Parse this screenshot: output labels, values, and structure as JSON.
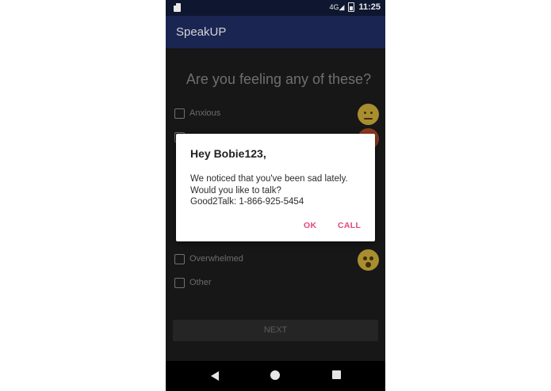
{
  "status_bar": {
    "network": "4G",
    "time": "11:25"
  },
  "app_bar": {
    "title": "SpeakUP"
  },
  "main": {
    "question": "Are you feeling any of these?",
    "options": [
      {
        "label": "Anxious"
      },
      {
        "label": ""
      },
      {
        "label": ""
      },
      {
        "label": ""
      },
      {
        "label": ""
      },
      {
        "label": ""
      },
      {
        "label": "Overwhelmed"
      },
      {
        "label": "Other"
      }
    ],
    "next_label": "NEXT"
  },
  "dialog": {
    "title": "Hey Bobie123,",
    "message_lines": [
      "We noticed that you've been sad lately.",
      "Would you like to talk?",
      "Good2Talk: 1-866-925-5454"
    ],
    "ok_label": "OK",
    "call_label": "CALL"
  },
  "colors": {
    "app_bar": "#1b2552",
    "status_bar": "#0f1630",
    "accent": "#e3467e",
    "background": "#171717"
  },
  "icons": [
    "sd-card-icon",
    "signal-icon",
    "battery-icon",
    "back-icon",
    "home-icon",
    "recents-icon"
  ]
}
